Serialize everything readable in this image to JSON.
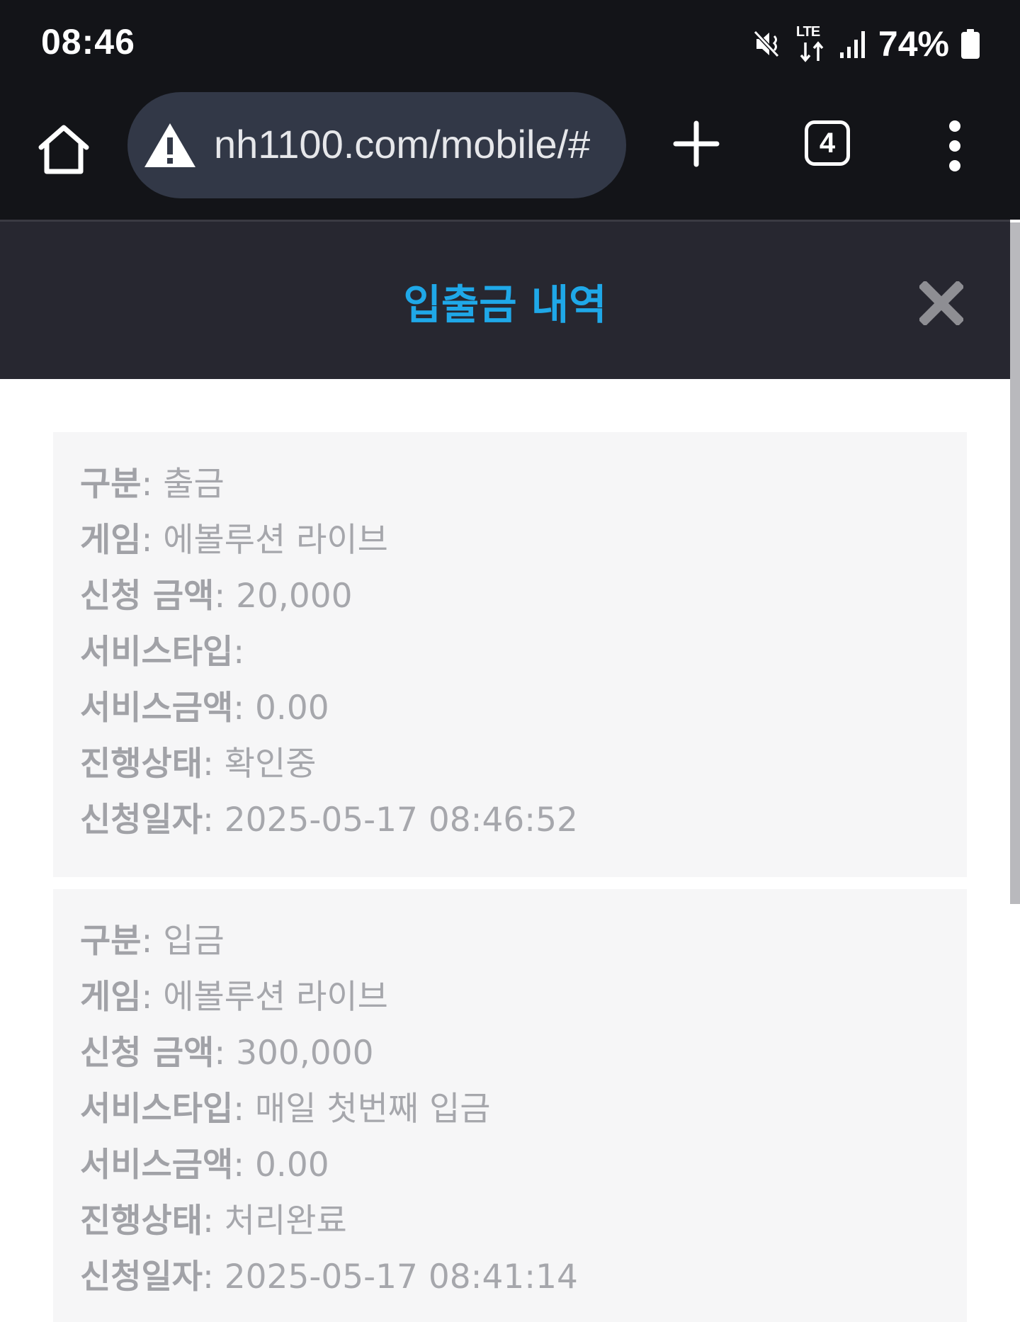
{
  "status_bar": {
    "time": "08:46",
    "network": "LTE",
    "battery": "74%",
    "icons": [
      "mute-icon",
      "lte-icon",
      "signal-icon",
      "battery-icon"
    ]
  },
  "browser": {
    "url": "nh1100.com/mobile/#",
    "tab_count": "4",
    "icons": [
      "home-icon",
      "warning-icon",
      "plus-icon",
      "tabs-icon",
      "more-vert-icon"
    ]
  },
  "page": {
    "title": "입출금 내역",
    "close_icon": "close-icon"
  },
  "records": [
    {
      "type_label": "구분",
      "type_value": "출금",
      "game_label": "게임",
      "game_value": "에볼루션 라이브",
      "amount_label": "신청 금액",
      "amount_value": "20,000",
      "service_type_label": "서비스타입",
      "service_type_value": "",
      "service_amount_label": "서비스금액",
      "service_amount_value": "0.00",
      "status_label": "진행상태",
      "status_value": "확인중",
      "date_label": "신청일자",
      "date_value": "2025-05-17 08:46:52"
    },
    {
      "type_label": "구분",
      "type_value": "입금",
      "game_label": "게임",
      "game_value": "에볼루션 라이브",
      "amount_label": "신청 금액",
      "amount_value": "300,000",
      "service_type_label": "서비스타입",
      "service_type_value": "매일 첫번째 입금",
      "service_amount_label": "서비스금액",
      "service_amount_value": "0.00",
      "status_label": "진행상태",
      "status_value": "처리완료",
      "date_label": "신청일자",
      "date_value": "2025-05-17 08:41:14"
    }
  ]
}
